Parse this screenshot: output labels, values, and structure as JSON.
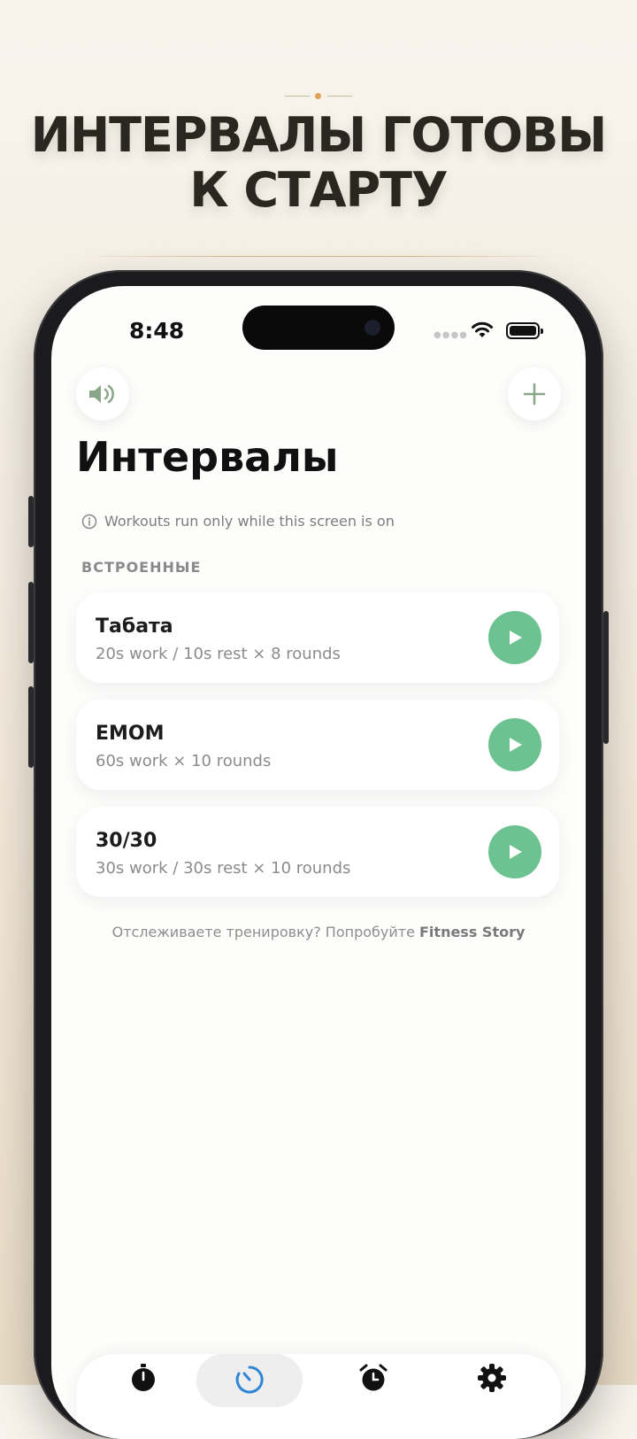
{
  "headline": {
    "line1": "ИНТЕРВАЛЫ ГОТОВЫ",
    "line2": "К СТАРТУ"
  },
  "status_bar": {
    "time": "8:48"
  },
  "header": {
    "left_icon": "speaker-icon",
    "right_icon": "plus-icon"
  },
  "page": {
    "title": "Интервалы",
    "notice": "Workouts run only while this screen is on",
    "section_label": "ВСТРОЕННЫЕ"
  },
  "workouts": [
    {
      "name": "Табата",
      "details": "20s work / 10s rest × 8 rounds"
    },
    {
      "name": "EMOM",
      "details": "60s work × 10 rounds"
    },
    {
      "name": "30/30",
      "details": "30s work / 30s rest × 10 rounds"
    }
  ],
  "promo": {
    "text": "Отслеживаете тренировку? Попробуйте ",
    "brand": "Fitness Story"
  },
  "tabs": [
    {
      "icon": "stopwatch-icon"
    },
    {
      "icon": "interval-timer-icon",
      "active": true
    },
    {
      "icon": "alarm-clock-icon"
    },
    {
      "icon": "gear-icon"
    }
  ],
  "colors": {
    "accent_green": "#6cc391",
    "icon_green": "#8aa688",
    "active_tab_blue": "#2f86d6"
  }
}
